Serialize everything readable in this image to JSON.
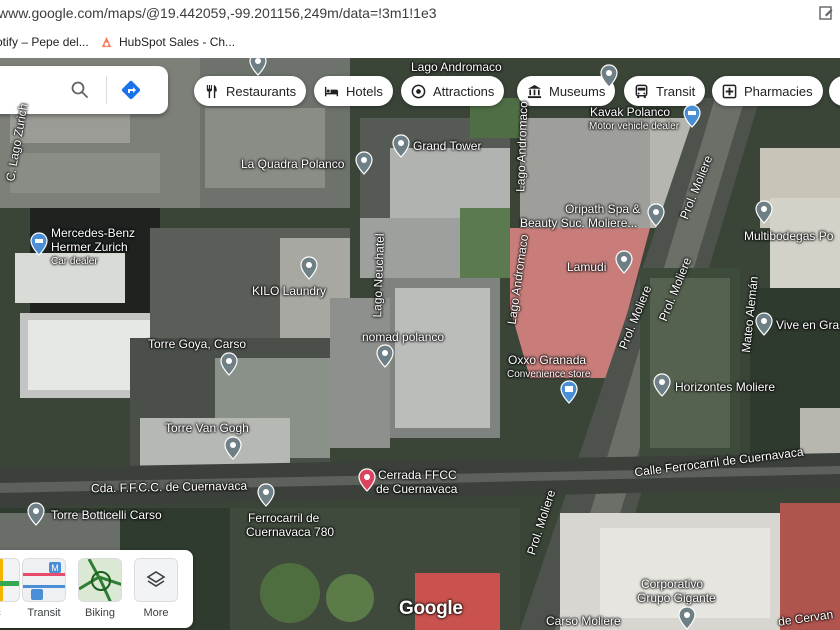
{
  "browser": {
    "url": "www.google.com/maps/@19.442059,-99.201156,249m/data=!3m1!1e3",
    "bookmarks": [
      {
        "label": "otify – Pepe del..."
      },
      {
        "label": "HubSpot Sales - Ch..."
      }
    ]
  },
  "search": {
    "search_icon": "search-icon",
    "directions_icon": "directions-icon"
  },
  "chips": [
    {
      "label": "Restaurants",
      "icon": "fork-knife-icon"
    },
    {
      "label": "Hotels",
      "icon": "bed-icon"
    },
    {
      "label": "Attractions",
      "icon": "camera-icon"
    },
    {
      "label": "Museums",
      "icon": "museum-icon"
    },
    {
      "label": "Transit",
      "icon": "bus-icon"
    },
    {
      "label": "Pharmacies",
      "icon": "pharmacy-icon"
    }
  ],
  "places": {
    "lago_andromaco_top": "Lago Andromaco",
    "kavak_name": "Kavak Polanco",
    "kavak_sub": "Motor vehicle dealer",
    "grand_tower": "Grand Tower",
    "la_quadra": "La Quadra Polanco",
    "lago_zurich": "C. Lago Zurich",
    "oripath_1": "Oripath Spa &",
    "oripath_2": "Beauty Suc. Moliere...",
    "mercedes_1": "Mercedes-Benz",
    "mercedes_2": "Hermer Zurich",
    "mercedes_sub": "Car dealer",
    "multibodegas": "Multibodegas Po",
    "lamudi": "Lamudi",
    "kilo": "KILO Laundry",
    "lago_neuchatel": "Lago Neuchatel",
    "lago_andromaco_side": "Lago Andromaco",
    "prol_moliere_a": "Prol. Moliere",
    "prol_moliere_b": "Prol. Moliere",
    "prol_moliere_c": "Prol. Moliere",
    "prol_moliere_d": "Prol. Moliere",
    "mateo_aleman": "Mateo Alemán",
    "vive": "Vive en Gra",
    "nomad": "nomad polanco",
    "torre_goya": "Torre Goya, Carso",
    "oxxo_1": "Oxxo Granada",
    "oxxo_sub": "Convenience store",
    "horizontes": "Horizontes Moliere",
    "torre_vangogh": "Torre Van Gogh",
    "calle_ferrocarril": "Calle Ferrocarril de Cuernavaca",
    "cda_ffcc": "Cda. F.F.C.C. de Cuernavaca",
    "cerrada_1": "Cerrada FFCC",
    "cerrada_2": "de Cuernavaca",
    "torre_botticelli": "Torre Botticelli Carso",
    "ferrocarril_1": "Ferrocarril de",
    "ferrocarril_2": "Cuernavaca 780",
    "corporativo_1": "Corporativo",
    "corporativo_2": "Grupo Gigante",
    "carso_moliere": "Carso Moliere",
    "cervan": "de Cervan"
  },
  "layers": [
    {
      "label": "c"
    },
    {
      "label": "Transit"
    },
    {
      "label": "Biking"
    },
    {
      "label": "More"
    }
  ],
  "logo": "Google",
  "colors": {
    "pin_gray": "#6f7f86",
    "pin_blue": "#4a8fd6",
    "pin_red": "#d9455f",
    "directions_blue": "#1a73e8"
  }
}
